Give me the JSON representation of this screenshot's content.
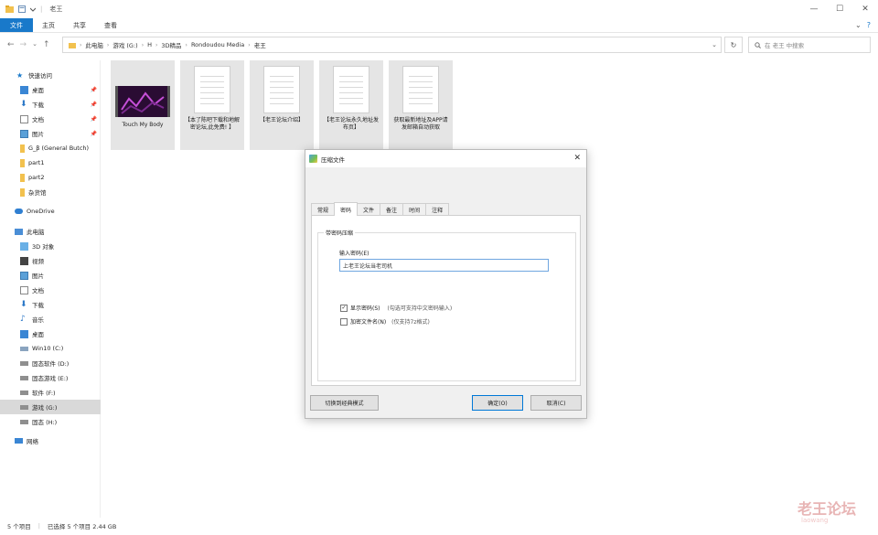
{
  "window": {
    "title": "老王",
    "controls": {
      "minimize": "—",
      "maximize": "☐",
      "close": "✕"
    }
  },
  "ribbon": {
    "tabs": [
      "文件",
      "主页",
      "共享",
      "查看"
    ],
    "right_chevron": "⌄",
    "help": "?"
  },
  "nav": {
    "back": "←",
    "forward": "→",
    "recent": "⌄",
    "up": "↑",
    "breadcrumbs": [
      "此电脑",
      "游戏 (G:)",
      "H",
      "3D精品",
      "Rondoudou Media",
      "老王"
    ],
    "dropdown": "⌄",
    "refresh": "↻",
    "search_placeholder": "在 老王 中搜索"
  },
  "sidebar": {
    "items": [
      {
        "label": "快速访问",
        "icon": "star-icon",
        "pinned": false
      },
      {
        "label": "桌面",
        "icon": "desktop-icon",
        "pinned": true
      },
      {
        "label": "下载",
        "icon": "download-icon",
        "pinned": true
      },
      {
        "label": "文档",
        "icon": "document-icon",
        "pinned": true
      },
      {
        "label": "图片",
        "icon": "picture-icon",
        "pinned": true
      },
      {
        "label": "G_β (General Butch)",
        "icon": "folder-icon",
        "pinned": false
      },
      {
        "label": "part1",
        "icon": "folder-icon",
        "pinned": false
      },
      {
        "label": "part2",
        "icon": "folder-icon",
        "pinned": false
      },
      {
        "label": "杂货馆",
        "icon": "folder-icon",
        "pinned": false
      },
      {
        "label": "OneDrive",
        "icon": "cloud-icon",
        "pinned": false
      },
      {
        "label": "此电脑",
        "icon": "computer-icon",
        "pinned": false
      },
      {
        "label": "3D 对象",
        "icon": "cube-icon",
        "pinned": false
      },
      {
        "label": "视频",
        "icon": "video-icon",
        "pinned": false
      },
      {
        "label": "图片",
        "icon": "picture-icon",
        "pinned": false
      },
      {
        "label": "文档",
        "icon": "document-icon",
        "pinned": false
      },
      {
        "label": "下载",
        "icon": "download-icon",
        "pinned": false
      },
      {
        "label": "音乐",
        "icon": "music-icon",
        "pinned": false
      },
      {
        "label": "桌面",
        "icon": "desktop-icon",
        "pinned": false
      },
      {
        "label": "Win10 (C:)",
        "icon": "drive-icon",
        "pinned": false
      },
      {
        "label": "固态软件 (D:)",
        "icon": "drive-icon",
        "pinned": false
      },
      {
        "label": "固态游戏 (E:)",
        "icon": "drive-icon",
        "pinned": false
      },
      {
        "label": "软件 (F:)",
        "icon": "drive-icon",
        "pinned": false
      },
      {
        "label": "游戏 (G:)",
        "icon": "drive-icon",
        "pinned": false,
        "selected": true
      },
      {
        "label": "固态 (H:)",
        "icon": "drive-icon",
        "pinned": false
      },
      {
        "label": "网络",
        "icon": "network-icon",
        "pinned": false
      }
    ],
    "pin_glyph": "📌"
  },
  "files": [
    {
      "name": "Touch My Body",
      "type": "video"
    },
    {
      "name": "【本了陈吧下载和地解密论坛,此免费! 】",
      "type": "text"
    },
    {
      "name": "【老王论坛介绍】",
      "type": "text"
    },
    {
      "name": "【老王论坛永久地址发布页】",
      "type": "text"
    },
    {
      "name": "获取最新地址及APP请发邮箱自动获取",
      "type": "text"
    }
  ],
  "status": {
    "item_count": "5 个项目",
    "selection": "已选择 5 个项目 2.44 GB"
  },
  "watermark": {
    "text": "老王论坛",
    "sub": "laowang"
  },
  "dialog": {
    "title": "压缩文件",
    "close": "✕",
    "tabs": [
      "常规",
      "密码",
      "文件",
      "备注",
      "时间",
      "注释"
    ],
    "active_tab": 1,
    "group_label": "带密码压缩",
    "password_label": "输入密码(E)",
    "password_value": "上老王论坛当老司机",
    "checkbox_show": {
      "label": "显示密码(S)",
      "hint": "(勾选可支持中文密码输入)",
      "checked": true
    },
    "checkbox_encrypt": {
      "label": "加密文件名(N)",
      "hint": "(仅支持7z格式)",
      "checked": false
    },
    "buttons": {
      "switch": "切换到经典模式",
      "ok": "确定(O)",
      "cancel": "取消(C)"
    }
  },
  "colors": {
    "file_tab": "#1979ca",
    "selection": "#d9d9d9",
    "tile_bg": "#e5e5e5",
    "dialog_bg": "#f0f0f0",
    "focus_border": "#0078d7"
  }
}
